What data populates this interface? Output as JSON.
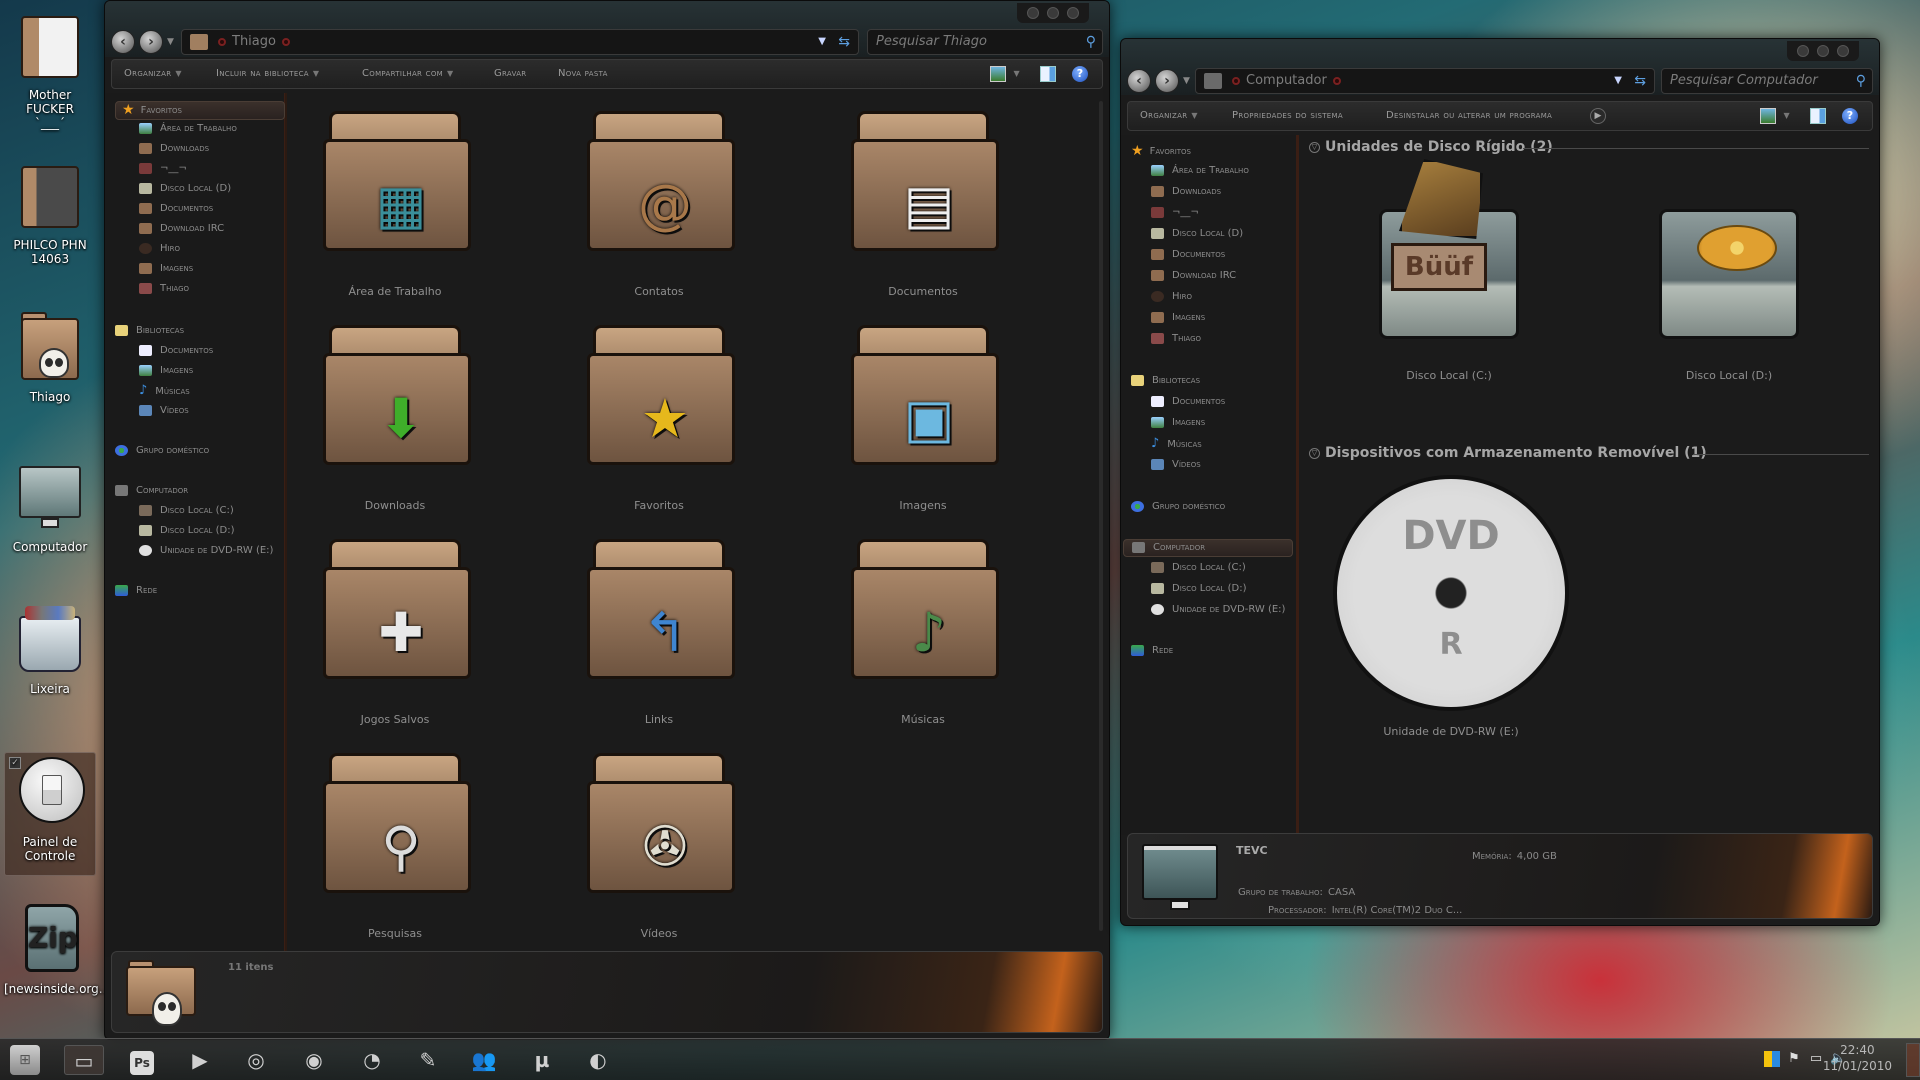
{
  "desktop": {
    "icons": [
      {
        "label": "Mother FUCKER",
        "sublabel": "`___´",
        "icon": "documents-folder-icon"
      },
      {
        "label": "PHILCO PHN 14063",
        "icon": "book-folder-icon"
      },
      {
        "label": "Thiago",
        "icon": "skull-folder-icon"
      },
      {
        "label": "Computador",
        "icon": "monitor-icon"
      },
      {
        "label": "Lixeira",
        "icon": "recycle-bin-icon"
      },
      {
        "label": "Painel de Controle",
        "icon": "light-switch-icon",
        "selected": true
      },
      {
        "label": "[newsinside.org...",
        "icon": "zip-file-icon"
      }
    ]
  },
  "left_window": {
    "address": {
      "location": "Thiago"
    },
    "search": {
      "placeholder": "Pesquisar Thiago"
    },
    "toolbar": {
      "organize": "Organizar",
      "include_library": "Incluir na biblioteca",
      "share_with": "Compartilhar com",
      "burn": "Gravar",
      "new_folder": "Nova pasta"
    },
    "sidebar": {
      "favorites": {
        "title": "Favoritos",
        "items": [
          "Área de Trabalho",
          "Downloads",
          "¬__¬",
          "Disco Local (D)",
          "Documentos",
          "Download IRC",
          "Hiro",
          "Imagens",
          "Thiago"
        ]
      },
      "libraries": {
        "title": "Bibliotecas",
        "items": [
          "Documentos",
          "Imagens",
          "Músicas",
          "Vídeos"
        ]
      },
      "homegroup": "Grupo doméstico",
      "computer": {
        "title": "Computador",
        "items": [
          "Disco Local (C:)",
          "Disco Local (D:)",
          "Unidade de DVD-RW (E:)"
        ]
      },
      "network": "Rede"
    },
    "files": [
      {
        "label": "Área de Trabalho",
        "badge": "desktop"
      },
      {
        "label": "Contatos",
        "badge": "contacts"
      },
      {
        "label": "Documentos",
        "badge": "documents"
      },
      {
        "label": "Downloads",
        "badge": "downloads"
      },
      {
        "label": "Favoritos",
        "badge": "favorites"
      },
      {
        "label": "Imagens",
        "badge": "pictures"
      },
      {
        "label": "Jogos Salvos",
        "badge": "saved-games"
      },
      {
        "label": "Links",
        "badge": "links"
      },
      {
        "label": "Músicas",
        "badge": "music"
      },
      {
        "label": "Pesquisas",
        "badge": "searches"
      },
      {
        "label": "Vídeos",
        "badge": "videos"
      }
    ],
    "status": {
      "item_count": "11 itens"
    }
  },
  "right_window": {
    "address": {
      "location": "Computador"
    },
    "search": {
      "placeholder": "Pesquisar Computador"
    },
    "toolbar": {
      "organize": "Organizar",
      "system_properties": "Propriedades do sistema",
      "uninstall": "Desinstalar ou alterar um programa"
    },
    "sidebar": {
      "favorites": {
        "title": "Favoritos",
        "items": [
          "Área de Trabalho",
          "Downloads",
          "¬__¬",
          "Disco Local (D)",
          "Documentos",
          "Download IRC",
          "Hiro",
          "Imagens",
          "Thiago"
        ]
      },
      "libraries": {
        "title": "Bibliotecas",
        "items": [
          "Documentos",
          "Imagens",
          "Músicas",
          "Vídeos"
        ]
      },
      "homegroup": "Grupo doméstico",
      "computer": {
        "title": "Computador",
        "items": [
          "Disco Local (C:)",
          "Disco Local (D:)",
          "Unidade de DVD-RW (E:)"
        ]
      },
      "network": "Rede"
    },
    "sections": {
      "hard_drives": {
        "title": "Unidades de Disco Rígido (2)",
        "items": [
          "Disco Local (C:)",
          "Disco Local (D:)"
        ]
      },
      "removable": {
        "title": "Dispositivos com Armazenamento Removível (1)",
        "items": [
          "Unidade de DVD-RW (E:)"
        ]
      }
    },
    "drive_c_sign": "Büüf",
    "dvd_text_top": "DVD",
    "dvd_text_bottom": "R",
    "details": {
      "computer_name": "TEVC",
      "memory_label": "Memória:",
      "memory_value": "4,00 GB",
      "workgroup_label": "Grupo de trabalho:",
      "workgroup_value": "CASA",
      "processor_label": "Processador:",
      "processor_value": "Intel(R) Core(TM)2 Duo C..."
    }
  },
  "taskbar": {
    "pinned": [
      "explorer",
      "photoshop",
      "media-player",
      "chrome",
      "firefox",
      "graphics-app",
      "pencil-app",
      "messenger",
      "utorrent",
      "steam"
    ],
    "ps_label": "Ps",
    "clock": {
      "time": "22:40",
      "date": "11/01/2010"
    }
  }
}
